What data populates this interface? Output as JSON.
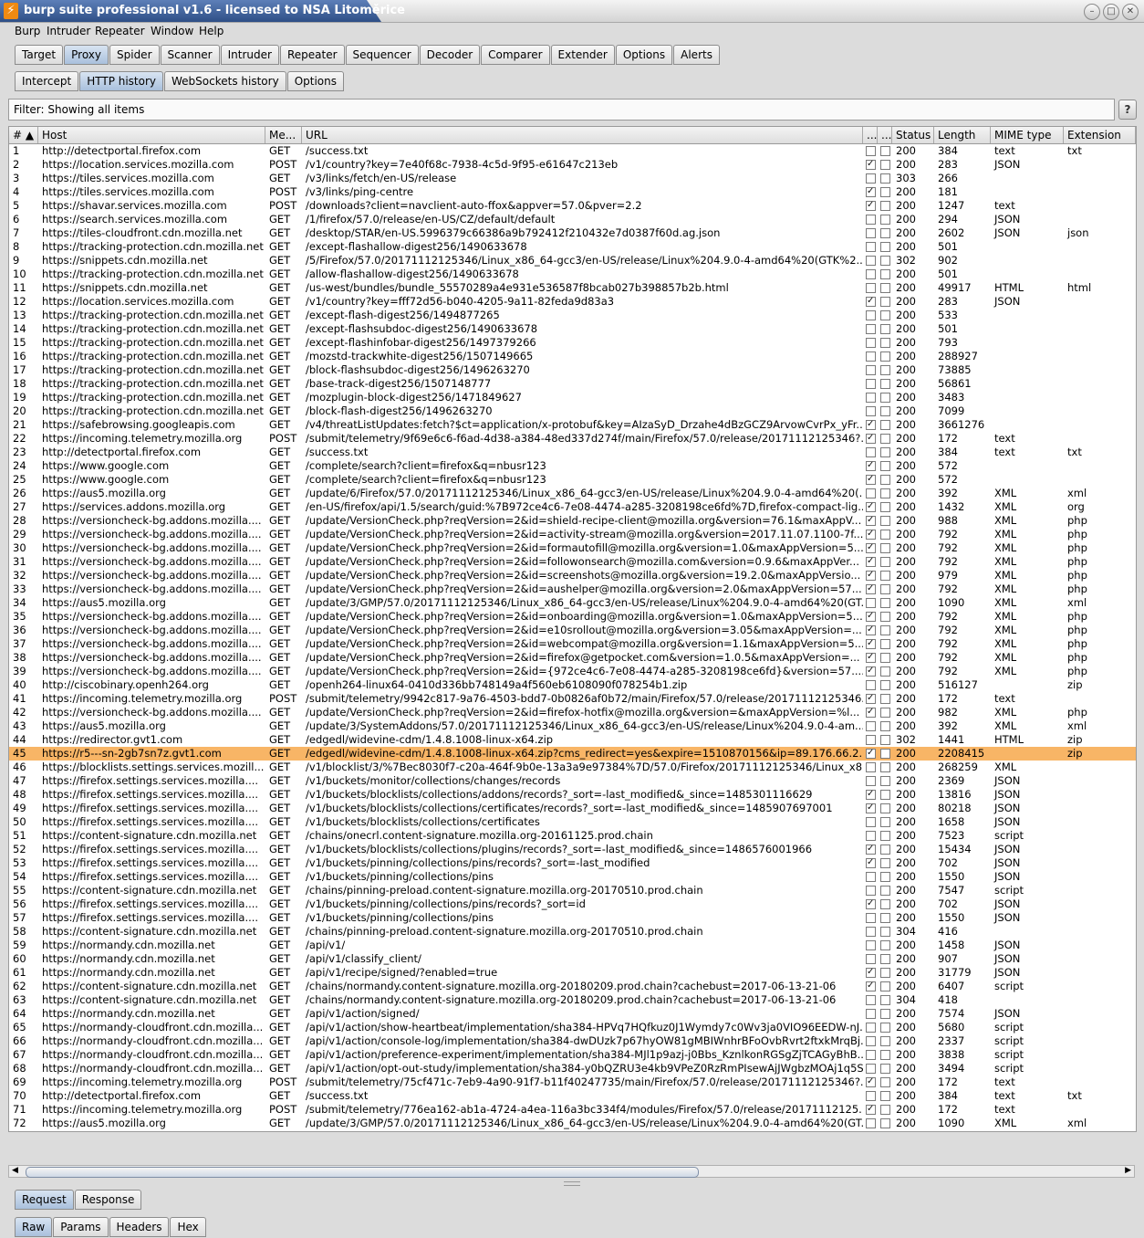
{
  "window": {
    "title": "burp suite professional v1.6 - licensed to NSA Litoměrice"
  },
  "menu": [
    "Burp",
    "Intruder",
    "Repeater",
    "Window",
    "Help"
  ],
  "main_tabs": [
    "Target",
    "Proxy",
    "Spider",
    "Scanner",
    "Intruder",
    "Repeater",
    "Sequencer",
    "Decoder",
    "Comparer",
    "Extender",
    "Options",
    "Alerts"
  ],
  "proxy_tabs": [
    "Intercept",
    "HTTP history",
    "WebSockets history",
    "Options"
  ],
  "filter": {
    "text": "Filter: Showing all items",
    "help": "?"
  },
  "columns": {
    "num": "# ▲",
    "host": "Host",
    "method": "Me...",
    "url": "URL",
    "c1": "...",
    "c2": "...",
    "status": "Status",
    "length": "Length",
    "mime": "MIME type",
    "ext": "Extension"
  },
  "selected_row": 45,
  "rows": [
    [
      "1",
      "http://detectportal.firefox.com",
      "GET",
      "/success.txt",
      0,
      "200",
      "384",
      "text",
      "txt"
    ],
    [
      "2",
      "https://location.services.mozilla.com",
      "POST",
      "/v1/country?key=7e40f68c-7938-4c5d-9f95-e61647c213eb",
      1,
      "200",
      "283",
      "JSON",
      ""
    ],
    [
      "3",
      "https://tiles.services.mozilla.com",
      "GET",
      "/v3/links/fetch/en-US/release",
      0,
      "303",
      "266",
      "",
      ""
    ],
    [
      "4",
      "https://tiles.services.mozilla.com",
      "POST",
      "/v3/links/ping-centre",
      1,
      "200",
      "181",
      "",
      ""
    ],
    [
      "5",
      "https://shavar.services.mozilla.com",
      "POST",
      "/downloads?client=navclient-auto-ffox&appver=57.0&pver=2.2",
      1,
      "200",
      "1247",
      "text",
      ""
    ],
    [
      "6",
      "https://search.services.mozilla.com",
      "GET",
      "/1/firefox/57.0/release/en-US/CZ/default/default",
      0,
      "200",
      "294",
      "JSON",
      ""
    ],
    [
      "7",
      "https://tiles-cloudfront.cdn.mozilla.net",
      "GET",
      "/desktop/STAR/en-US.5996379c66386a9b792412f210432e7d0387f60d.ag.json",
      0,
      "200",
      "2602",
      "JSON",
      "json"
    ],
    [
      "8",
      "https://tracking-protection.cdn.mozilla.net",
      "GET",
      "/except-flashallow-digest256/1490633678",
      0,
      "200",
      "501",
      "",
      ""
    ],
    [
      "9",
      "https://snippets.cdn.mozilla.net",
      "GET",
      "/5/Firefox/57.0/20171112125346/Linux_x86_64-gcc3/en-US/release/Linux%204.9.0-4-amd64%20(GTK%2...",
      0,
      "302",
      "902",
      "",
      ""
    ],
    [
      "10",
      "https://tracking-protection.cdn.mozilla.net",
      "GET",
      "/allow-flashallow-digest256/1490633678",
      0,
      "200",
      "501",
      "",
      ""
    ],
    [
      "11",
      "https://snippets.cdn.mozilla.net",
      "GET",
      "/us-west/bundles/bundle_55570289a4e931e536587f8bcab027b398857b2b.html",
      0,
      "200",
      "49917",
      "HTML",
      "html"
    ],
    [
      "12",
      "https://location.services.mozilla.com",
      "GET",
      "/v1/country?key=fff72d56-b040-4205-9a11-82feda9d83a3",
      1,
      "200",
      "283",
      "JSON",
      ""
    ],
    [
      "13",
      "https://tracking-protection.cdn.mozilla.net",
      "GET",
      "/except-flash-digest256/1494877265",
      0,
      "200",
      "533",
      "",
      ""
    ],
    [
      "14",
      "https://tracking-protection.cdn.mozilla.net",
      "GET",
      "/except-flashsubdoc-digest256/1490633678",
      0,
      "200",
      "501",
      "",
      ""
    ],
    [
      "15",
      "https://tracking-protection.cdn.mozilla.net",
      "GET",
      "/except-flashinfobar-digest256/1497379266",
      0,
      "200",
      "793",
      "",
      ""
    ],
    [
      "16",
      "https://tracking-protection.cdn.mozilla.net",
      "GET",
      "/mozstd-trackwhite-digest256/1507149665",
      0,
      "200",
      "288927",
      "",
      ""
    ],
    [
      "17",
      "https://tracking-protection.cdn.mozilla.net",
      "GET",
      "/block-flashsubdoc-digest256/1496263270",
      0,
      "200",
      "73885",
      "",
      ""
    ],
    [
      "18",
      "https://tracking-protection.cdn.mozilla.net",
      "GET",
      "/base-track-digest256/1507148777",
      0,
      "200",
      "56861",
      "",
      ""
    ],
    [
      "19",
      "https://tracking-protection.cdn.mozilla.net",
      "GET",
      "/mozplugin-block-digest256/1471849627",
      0,
      "200",
      "3483",
      "",
      ""
    ],
    [
      "20",
      "https://tracking-protection.cdn.mozilla.net",
      "GET",
      "/block-flash-digest256/1496263270",
      0,
      "200",
      "7099",
      "",
      ""
    ],
    [
      "21",
      "https://safebrowsing.googleapis.com",
      "GET",
      "/v4/threatListUpdates:fetch?$ct=application/x-protobuf&key=AIzaSyD_Drzahe4dBzGCZ9ArvowCvrPx_yFr...",
      1,
      "200",
      "3661276",
      "",
      ""
    ],
    [
      "22",
      "https://incoming.telemetry.mozilla.org",
      "POST",
      "/submit/telemetry/9f69e6c6-f6ad-4d38-a384-48ed337d274f/main/Firefox/57.0/release/20171112125346?...",
      1,
      "200",
      "172",
      "text",
      ""
    ],
    [
      "23",
      "http://detectportal.firefox.com",
      "GET",
      "/success.txt",
      0,
      "200",
      "384",
      "text",
      "txt"
    ],
    [
      "24",
      "https://www.google.com",
      "GET",
      "/complete/search?client=firefox&q=nbusr123",
      1,
      "200",
      "572",
      "",
      ""
    ],
    [
      "25",
      "https://www.google.com",
      "GET",
      "/complete/search?client=firefox&q=nbusr123",
      1,
      "200",
      "572",
      "",
      ""
    ],
    [
      "26",
      "https://aus5.mozilla.org",
      "GET",
      "/update/6/Firefox/57.0/20171112125346/Linux_x86_64-gcc3/en-US/release/Linux%204.9.0-4-amd64%20(...",
      0,
      "200",
      "392",
      "XML",
      "xml"
    ],
    [
      "27",
      "https://services.addons.mozilla.org",
      "GET",
      "/en-US/firefox/api/1.5/search/guid:%7B972ce4c6-7e08-4474-a285-3208198ce6fd%7D,firefox-compact-lig...",
      1,
      "200",
      "1432",
      "XML",
      "org"
    ],
    [
      "28",
      "https://versioncheck-bg.addons.mozilla....",
      "GET",
      "/update/VersionCheck.php?reqVersion=2&id=shield-recipe-client@mozilla.org&version=76.1&maxAppV...",
      1,
      "200",
      "988",
      "XML",
      "php"
    ],
    [
      "29",
      "https://versioncheck-bg.addons.mozilla....",
      "GET",
      "/update/VersionCheck.php?reqVersion=2&id=activity-stream@mozilla.org&version=2017.11.07.1100-7f...",
      1,
      "200",
      "792",
      "XML",
      "php"
    ],
    [
      "30",
      "https://versioncheck-bg.addons.mozilla....",
      "GET",
      "/update/VersionCheck.php?reqVersion=2&id=formautofill@mozilla.org&version=1.0&maxAppVersion=5...",
      1,
      "200",
      "792",
      "XML",
      "php"
    ],
    [
      "31",
      "https://versioncheck-bg.addons.mozilla....",
      "GET",
      "/update/VersionCheck.php?reqVersion=2&id=followonsearch@mozilla.com&version=0.9.6&maxAppVer...",
      1,
      "200",
      "792",
      "XML",
      "php"
    ],
    [
      "32",
      "https://versioncheck-bg.addons.mozilla....",
      "GET",
      "/update/VersionCheck.php?reqVersion=2&id=screenshots@mozilla.org&version=19.2.0&maxAppVersio...",
      1,
      "200",
      "979",
      "XML",
      "php"
    ],
    [
      "33",
      "https://versioncheck-bg.addons.mozilla....",
      "GET",
      "/update/VersionCheck.php?reqVersion=2&id=aushelper@mozilla.org&version=2.0&maxAppVersion=57...",
      1,
      "200",
      "792",
      "XML",
      "php"
    ],
    [
      "34",
      "https://aus5.mozilla.org",
      "GET",
      "/update/3/GMP/57.0/20171112125346/Linux_x86_64-gcc3/en-US/release/Linux%204.9.0-4-amd64%20(GT...",
      0,
      "200",
      "1090",
      "XML",
      "xml"
    ],
    [
      "35",
      "https://versioncheck-bg.addons.mozilla....",
      "GET",
      "/update/VersionCheck.php?reqVersion=2&id=onboarding@mozilla.org&version=1.0&maxAppVersion=5...",
      1,
      "200",
      "792",
      "XML",
      "php"
    ],
    [
      "36",
      "https://versioncheck-bg.addons.mozilla....",
      "GET",
      "/update/VersionCheck.php?reqVersion=2&id=e10srollout@mozilla.org&version=3.05&maxAppVersion=...",
      1,
      "200",
      "792",
      "XML",
      "php"
    ],
    [
      "37",
      "https://versioncheck-bg.addons.mozilla....",
      "GET",
      "/update/VersionCheck.php?reqVersion=2&id=webcompat@mozilla.org&version=1.1&maxAppVersion=5...",
      1,
      "200",
      "792",
      "XML",
      "php"
    ],
    [
      "38",
      "https://versioncheck-bg.addons.mozilla....",
      "GET",
      "/update/VersionCheck.php?reqVersion=2&id=firefox@getpocket.com&version=1.0.5&maxAppVersion=...",
      1,
      "200",
      "792",
      "XML",
      "php"
    ],
    [
      "39",
      "https://versioncheck-bg.addons.mozilla....",
      "GET",
      "/update/VersionCheck.php?reqVersion=2&id={972ce4c6-7e08-4474-a285-3208198ce6fd}&version=57....",
      1,
      "200",
      "792",
      "XML",
      "php"
    ],
    [
      "40",
      "http://ciscobinary.openh264.org",
      "GET",
      "/openh264-linux64-0410d336bb748149a4f560eb6108090f078254b1.zip",
      0,
      "200",
      "516127",
      "",
      "zip"
    ],
    [
      "41",
      "https://incoming.telemetry.mozilla.org",
      "POST",
      "/submit/telemetry/9942c817-9a76-4503-bdd7-0b0826af0b72/main/Firefox/57.0/release/20171112125346...",
      1,
      "200",
      "172",
      "text",
      ""
    ],
    [
      "42",
      "https://versioncheck-bg.addons.mozilla....",
      "GET",
      "/update/VersionCheck.php?reqVersion=2&id=firefox-hotfix@mozilla.org&version=&maxAppVersion=%l...",
      1,
      "200",
      "982",
      "XML",
      "php"
    ],
    [
      "43",
      "https://aus5.mozilla.org",
      "GET",
      "/update/3/SystemAddons/57.0/20171112125346/Linux_x86_64-gcc3/en-US/release/Linux%204.9.0-4-am...",
      0,
      "200",
      "392",
      "XML",
      "xml"
    ],
    [
      "44",
      "https://redirector.gvt1.com",
      "GET",
      "/edgedl/widevine-cdm/1.4.8.1008-linux-x64.zip",
      0,
      "302",
      "1441",
      "HTML",
      "zip"
    ],
    [
      "45",
      "https://r5---sn-2gb7sn7z.gvt1.com",
      "GET",
      "/edgedl/widevine-cdm/1.4.8.1008-linux-x64.zip?cms_redirect=yes&expire=1510870156&ip=89.176.66.2...",
      1,
      "200",
      "2208415",
      "",
      "zip"
    ],
    [
      "46",
      "https://blocklists.settings.services.mozill...",
      "GET",
      "/v1/blocklist/3/%7Bec8030f7-c20a-464f-9b0e-13a3a9e97384%7D/57.0/Firefox/20171112125346/Linux_x8...",
      0,
      "200",
      "268259",
      "XML",
      ""
    ],
    [
      "47",
      "https://firefox.settings.services.mozilla....",
      "GET",
      "/v1/buckets/monitor/collections/changes/records",
      0,
      "200",
      "2369",
      "JSON",
      ""
    ],
    [
      "48",
      "https://firefox.settings.services.mozilla....",
      "GET",
      "/v1/buckets/blocklists/collections/addons/records?_sort=-last_modified&_since=1485301116629",
      1,
      "200",
      "13816",
      "JSON",
      ""
    ],
    [
      "49",
      "https://firefox.settings.services.mozilla....",
      "GET",
      "/v1/buckets/blocklists/collections/certificates/records?_sort=-last_modified&_since=1485907697001",
      1,
      "200",
      "80218",
      "JSON",
      ""
    ],
    [
      "50",
      "https://firefox.settings.services.mozilla....",
      "GET",
      "/v1/buckets/blocklists/collections/certificates",
      0,
      "200",
      "1658",
      "JSON",
      ""
    ],
    [
      "51",
      "https://content-signature.cdn.mozilla.net",
      "GET",
      "/chains/onecrl.content-signature.mozilla.org-20161125.prod.chain",
      0,
      "200",
      "7523",
      "script",
      ""
    ],
    [
      "52",
      "https://firefox.settings.services.mozilla....",
      "GET",
      "/v1/buckets/blocklists/collections/plugins/records?_sort=-last_modified&_since=1486576001966",
      1,
      "200",
      "15434",
      "JSON",
      ""
    ],
    [
      "53",
      "https://firefox.settings.services.mozilla....",
      "GET",
      "/v1/buckets/pinning/collections/pins/records?_sort=-last_modified",
      1,
      "200",
      "702",
      "JSON",
      ""
    ],
    [
      "54",
      "https://firefox.settings.services.mozilla....",
      "GET",
      "/v1/buckets/pinning/collections/pins",
      0,
      "200",
      "1550",
      "JSON",
      ""
    ],
    [
      "55",
      "https://content-signature.cdn.mozilla.net",
      "GET",
      "/chains/pinning-preload.content-signature.mozilla.org-20170510.prod.chain",
      0,
      "200",
      "7547",
      "script",
      ""
    ],
    [
      "56",
      "https://firefox.settings.services.mozilla....",
      "GET",
      "/v1/buckets/pinning/collections/pins/records?_sort=id",
      1,
      "200",
      "702",
      "JSON",
      ""
    ],
    [
      "57",
      "https://firefox.settings.services.mozilla....",
      "GET",
      "/v1/buckets/pinning/collections/pins",
      0,
      "200",
      "1550",
      "JSON",
      ""
    ],
    [
      "58",
      "https://content-signature.cdn.mozilla.net",
      "GET",
      "/chains/pinning-preload.content-signature.mozilla.org-20170510.prod.chain",
      0,
      "304",
      "416",
      "",
      ""
    ],
    [
      "59",
      "https://normandy.cdn.mozilla.net",
      "GET",
      "/api/v1/",
      0,
      "200",
      "1458",
      "JSON",
      ""
    ],
    [
      "60",
      "https://normandy.cdn.mozilla.net",
      "GET",
      "/api/v1/classify_client/",
      0,
      "200",
      "907",
      "JSON",
      ""
    ],
    [
      "61",
      "https://normandy.cdn.mozilla.net",
      "GET",
      "/api/v1/recipe/signed/?enabled=true",
      1,
      "200",
      "31779",
      "JSON",
      ""
    ],
    [
      "62",
      "https://content-signature.cdn.mozilla.net",
      "GET",
      "/chains/normandy.content-signature.mozilla.org-20180209.prod.chain?cachebust=2017-06-13-21-06",
      1,
      "200",
      "6407",
      "script",
      ""
    ],
    [
      "63",
      "https://content-signature.cdn.mozilla.net",
      "GET",
      "/chains/normandy.content-signature.mozilla.org-20180209.prod.chain?cachebust=2017-06-13-21-06",
      0,
      "304",
      "418",
      "",
      ""
    ],
    [
      "64",
      "https://normandy.cdn.mozilla.net",
      "GET",
      "/api/v1/action/signed/",
      0,
      "200",
      "7574",
      "JSON",
      ""
    ],
    [
      "65",
      "https://normandy-cloudfront.cdn.mozilla...",
      "GET",
      "/api/v1/action/show-heartbeat/implementation/sha384-HPVq7HQfkuz0J1Wymdy7c0Wv3ja0VIO96EEDW-nJ...",
      0,
      "200",
      "5680",
      "script",
      ""
    ],
    [
      "66",
      "https://normandy-cloudfront.cdn.mozilla...",
      "GET",
      "/api/v1/action/console-log/implementation/sha384-dwDUzk7p67hyOW81gMBIWnhrBFoOvbRvrt2ftxkMrqBj...",
      0,
      "200",
      "2337",
      "script",
      ""
    ],
    [
      "67",
      "https://normandy-cloudfront.cdn.mozilla...",
      "GET",
      "/api/v1/action/preference-experiment/implementation/sha384-MJl1p9azj-j0Bbs_KznlkonRGSgZjTCAGyBhB...",
      0,
      "200",
      "3838",
      "script",
      ""
    ],
    [
      "68",
      "https://normandy-cloudfront.cdn.mozilla...",
      "GET",
      "/api/v1/action/opt-out-study/implementation/sha384-y0bQZRU3e4kb9VPeZ0RzRmPIsewAjJWgbzMOAj1q5S...",
      0,
      "200",
      "3494",
      "script",
      ""
    ],
    [
      "69",
      "https://incoming.telemetry.mozilla.org",
      "POST",
      "/submit/telemetry/75cf471c-7eb9-4a90-91f7-b11f40247735/main/Firefox/57.0/release/20171112125346?...",
      1,
      "200",
      "172",
      "text",
      ""
    ],
    [
      "70",
      "http://detectportal.firefox.com",
      "GET",
      "/success.txt",
      0,
      "200",
      "384",
      "text",
      "txt"
    ],
    [
      "71",
      "https://incoming.telemetry.mozilla.org",
      "POST",
      "/submit/telemetry/776ea162-ab1a-4724-a4ea-116a3bc334f4/modules/Firefox/57.0/release/20171112125...",
      1,
      "200",
      "172",
      "text",
      ""
    ],
    [
      "72",
      "https://aus5.mozilla.org",
      "GET",
      "/update/3/GMP/57.0/20171112125346/Linux_x86_64-gcc3/en-US/release/Linux%204.9.0-4-amd64%20(GT...",
      0,
      "200",
      "1090",
      "XML",
      "xml"
    ]
  ],
  "detail_tabs": [
    "Request",
    "Response"
  ],
  "view_tabs": [
    "Raw",
    "Params",
    "Headers",
    "Hex"
  ]
}
